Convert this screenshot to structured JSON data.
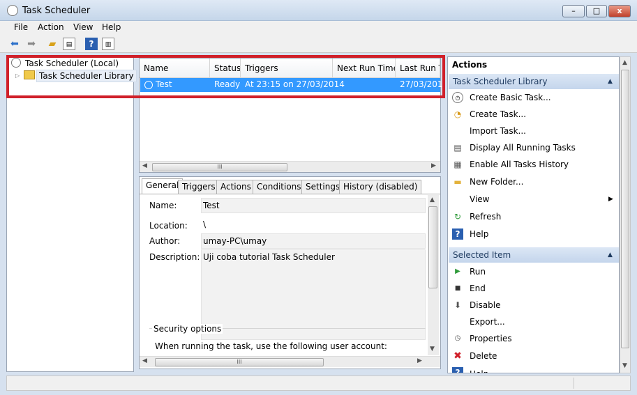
{
  "window": {
    "title": "Task Scheduler",
    "min_label": "–",
    "max_label": "□",
    "close_label": "x"
  },
  "menu": [
    "File",
    "Action",
    "View",
    "Help"
  ],
  "toolbar": {
    "back": "back-arrow-icon",
    "forward": "forward-arrow-icon",
    "up": "folder-up-icon",
    "showhide": "show-hide-tree-icon",
    "help": "help-icon",
    "panel": "action-pane-icon"
  },
  "tree": {
    "root": "Task Scheduler (Local)",
    "library": "Task Scheduler Library"
  },
  "tasklist": {
    "columns": [
      "Name",
      "Status",
      "Triggers",
      "Next Run Time",
      "Last Run Ti"
    ],
    "row": {
      "name": "Test",
      "status": "Ready",
      "triggers": "At 23:15 on 27/03/2014",
      "next_run": "",
      "last_run": "27/03/201"
    },
    "scroll_grip": "III"
  },
  "detail": {
    "tabs": [
      "General",
      "Triggers",
      "Actions",
      "Conditions",
      "Settings",
      "History (disabled)"
    ],
    "name_label": "Name:",
    "name_value": "Test",
    "location_label": "Location:",
    "location_value": "\\",
    "author_label": "Author:",
    "author_value": "umay-PC\\umay",
    "description_label": "Description:",
    "description_value": "Uji coba tutorial Task Scheduler",
    "security_title": "Security options",
    "security_text": "When running the task, use the following user account:",
    "scroll_grip": "III"
  },
  "actions": {
    "title": "Actions",
    "library_header": "Task Scheduler Library",
    "library_items": [
      "Create Basic Task...",
      "Create Task...",
      "Import Task...",
      "Display All Running Tasks",
      "Enable All Tasks History",
      "New Folder...",
      "View",
      "Refresh",
      "Help"
    ],
    "selected_header": "Selected Item",
    "selected_items": [
      "Run",
      "End",
      "Disable",
      "Export...",
      "Properties",
      "Delete",
      "Help"
    ]
  },
  "colors": {
    "selection": "#3399ff",
    "highlight_border": "#d0202a",
    "section_header": "#c4d5ec"
  }
}
